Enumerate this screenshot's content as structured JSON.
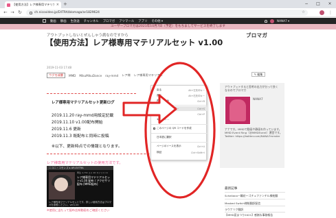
{
  "browser": {
    "tab_title": "【使用方法】レア様専用マテリアルセ",
    "tab_close": "×",
    "new_tab": "+",
    "url": "ch.nicovideo.jp/EXTRA/blomaga/ar1829624",
    "back": "←",
    "forward": "→",
    "reload": "↻",
    "star": "☆",
    "kebab": "⋮",
    "minimize": "−",
    "maximize": "□",
    "close": "×"
  },
  "niconav": {
    "items": [
      "動画",
      "静画",
      "生放送",
      "チャンネル",
      "ブロマガ",
      "アツマール",
      "アプリ",
      "その他 ▾"
    ],
    "user": "NANA7 ▾"
  },
  "notice": "ユーザーブロマガは2021年10月7日（予定）をもちましてサービスを終了します",
  "blog": {
    "tagline": "アウトプットしないとぜんしゃう病なのですから",
    "logo": "ブロマガ",
    "title": "【使用方法】レア様専用マテリアルセット v1.00",
    "meta": "2019-11-03 17:48",
    "tags": [
      "ウグモ成層",
      "MMD",
      "MikuMikuDance",
      "ray-mmd",
      "レア様",
      "レア様専用マテリアル"
    ],
    "edit_label": "✎ 編集"
  },
  "content": {
    "section_title": "レア様専用マテリアルセット更新ログ",
    "log": [
      "2019.11.20 ray-mmd用設定記載",
      "2019.11.10 v1.00配布開始",
      "2019.11.6 更新",
      "2019.11.3 既配布と同時に投稿"
    ],
    "note": "※以下、更新時点での情報となります。",
    "pink_link": "レア様専用マテリアルセットの使用方法です。",
    "embed_foot": "※使用に当たって配布告知動画をご確認ください"
  },
  "embed": {
    "header": "ニコニ・コモンズ ▸ AR-EXTRA",
    "stats": "再生 4,730 コメ 26 マイリス 11",
    "title": "レア様専用マテリアルセットv1.00 配布 / アクセサリ配布 [MMD配布]",
    "desc": "レア様専用マテリアルセットです。詳しい使用方法はブロマガを参照ください。ver1.00"
  },
  "context_menu": {
    "items": [
      {
        "label": "戻る",
        "key": "Alt+左矢印キー"
      },
      {
        "label": "進む",
        "key": "Alt+右矢印キー"
      },
      {
        "label": "再読み込み",
        "key": "Ctrl+R"
      },
      {
        "label": "名前を付けて保存...",
        "key": "Ctrl+S"
      },
      {
        "label": "印刷...",
        "key": "Ctrl+P"
      },
      {
        "label": "キャスト...",
        "key": ""
      },
      {
        "label": "このページの QR コードを作成",
        "key": ""
      },
      {
        "label": "日本語に翻訳",
        "key": ""
      },
      {
        "label": "ページのソースを表示",
        "key": "Ctrl+U"
      },
      {
        "label": "検証",
        "key": "Ctrl+Shift+I"
      }
    ]
  },
  "sidebar": {
    "profile_intro": "アウトプットすると思考の出力が分って良くなるのでブロマガ",
    "name": "NANA7",
    "profile_desc": "ナナです。MMDで動画や静画を作っています。MMD Event Ring（@MMDEvent）運営です。Twitter: https://twitter.com/NANA7mmder",
    "latest_title": "最新記事",
    "latest_items": [
      "Scheliana一輪花～ゴチュファンチル様絵翻",
      "Masked Switch様絵翻訳配信",
      "ラウナリク翻訳",
      "【MMD夏まつり2021】感謝＆事務報告",
      "東雲始子衣装替 2～3er MooLaa様絵"
    ]
  },
  "colors": {
    "annotation_red": "#e12525",
    "notice_bg": "#e9b7c0",
    "nav_bg": "#252525",
    "pink": "#f06a9a"
  }
}
